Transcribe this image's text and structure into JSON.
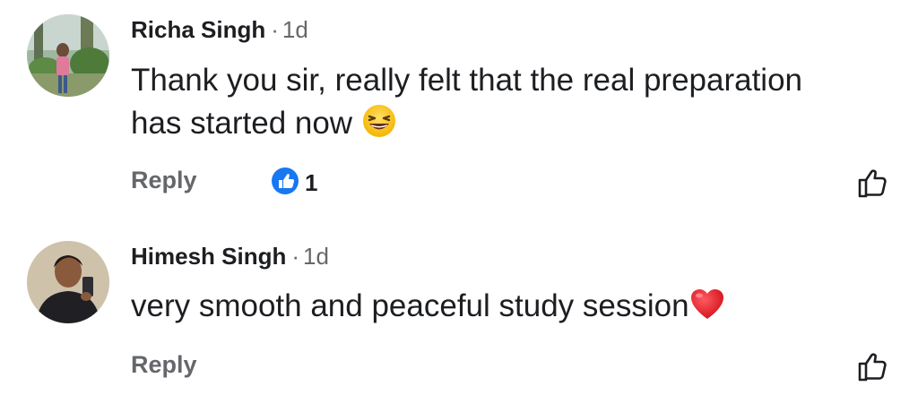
{
  "comments": [
    {
      "author": "Richa Singh",
      "separator": "·",
      "time": "1d",
      "text_line1": "Thank you sir, really felt that the real preparation",
      "text_line2": "has started now",
      "emoji": "grinning-squinting-face",
      "reply_label": "Reply",
      "like_count": "1"
    },
    {
      "author": "Himesh Singh",
      "separator": "·",
      "time": "1d",
      "text": "very smooth and peaceful study session",
      "emoji": "red-heart",
      "reply_label": "Reply"
    }
  ],
  "colors": {
    "name": "#1c1e21",
    "meta": "#65676b",
    "like_blue": "#1877f2",
    "heart_red": "#e8222e"
  },
  "icons": [
    "thumbs-up-reaction-icon",
    "thumbs-up-outline-icon",
    "grinning-squinting-face-emoji",
    "red-heart-emoji"
  ]
}
